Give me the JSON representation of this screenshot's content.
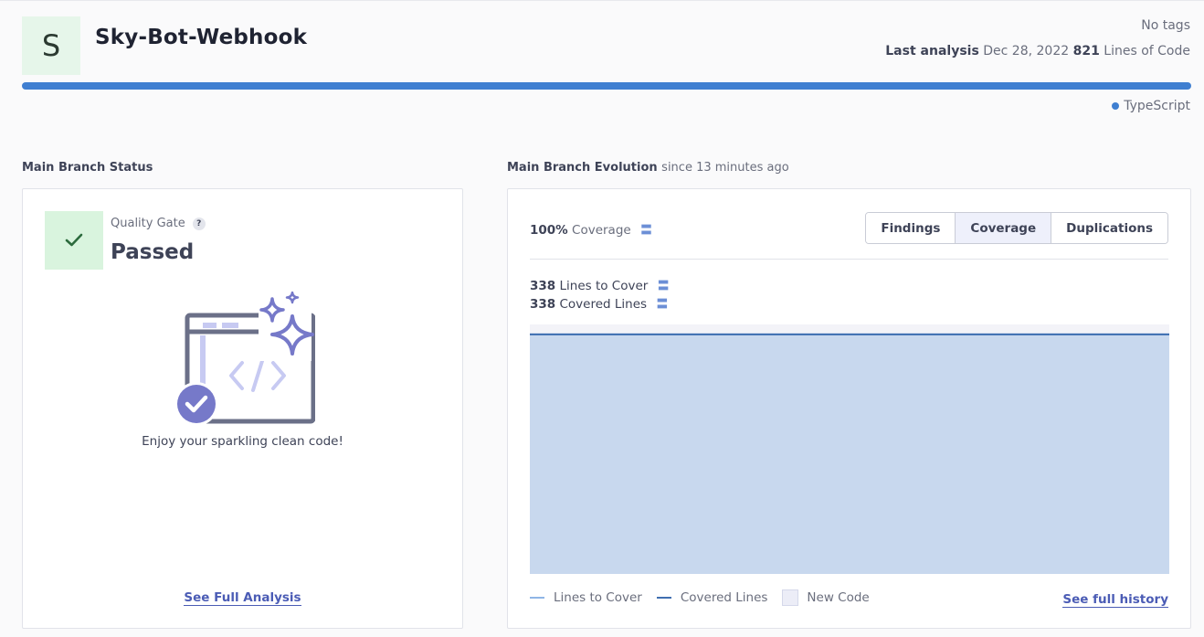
{
  "project": {
    "avatar_letter": "S",
    "name": "Sky-Bot-Webhook",
    "tags": "No tags",
    "last_analysis_label": "Last analysis",
    "last_analysis_date": "Dec 28, 2022",
    "loc_value": "821",
    "loc_label": "Lines of Code",
    "language": "TypeScript",
    "language_share": 1.0,
    "accent_color": "#3f7fd1"
  },
  "status": {
    "section_title": "Main Branch Status",
    "quality_gate_label": "Quality Gate",
    "help_label": "?",
    "quality_gate_status": "Passed",
    "enjoy_text": "Enjoy your sparkling clean code!",
    "see_full_analysis": "See Full Analysis",
    "passed_color": "#d9f4de"
  },
  "evolution": {
    "section_title": "Main Branch Evolution",
    "since": "since 13 minutes ago",
    "coverage_value": "100%",
    "coverage_label": "Coverage",
    "tabs": [
      {
        "label": "Findings",
        "active": false
      },
      {
        "label": "Coverage",
        "active": true
      },
      {
        "label": "Duplications",
        "active": false
      }
    ],
    "metrics": [
      {
        "value": "338",
        "label": "Lines to Cover"
      },
      {
        "value": "338",
        "label": "Covered Lines"
      }
    ],
    "legend": {
      "lines_to_cover": "Lines to Cover",
      "covered_lines": "Covered Lines",
      "new_code": "New Code"
    },
    "see_full_history": "See full history"
  },
  "chart_data": {
    "type": "area",
    "series": [
      {
        "name": "Lines to Cover",
        "values": [
          338,
          338
        ]
      },
      {
        "name": "Covered Lines",
        "values": [
          338,
          338
        ]
      }
    ],
    "ylim": [
      0,
      352
    ],
    "grid": false,
    "legend": "bottom-left",
    "colors": {
      "lines_to_cover": "#8fb5e6",
      "covered_lines": "#3f6fb0",
      "fill": "#c8d8ee",
      "new_code": "#ecedf7"
    }
  }
}
